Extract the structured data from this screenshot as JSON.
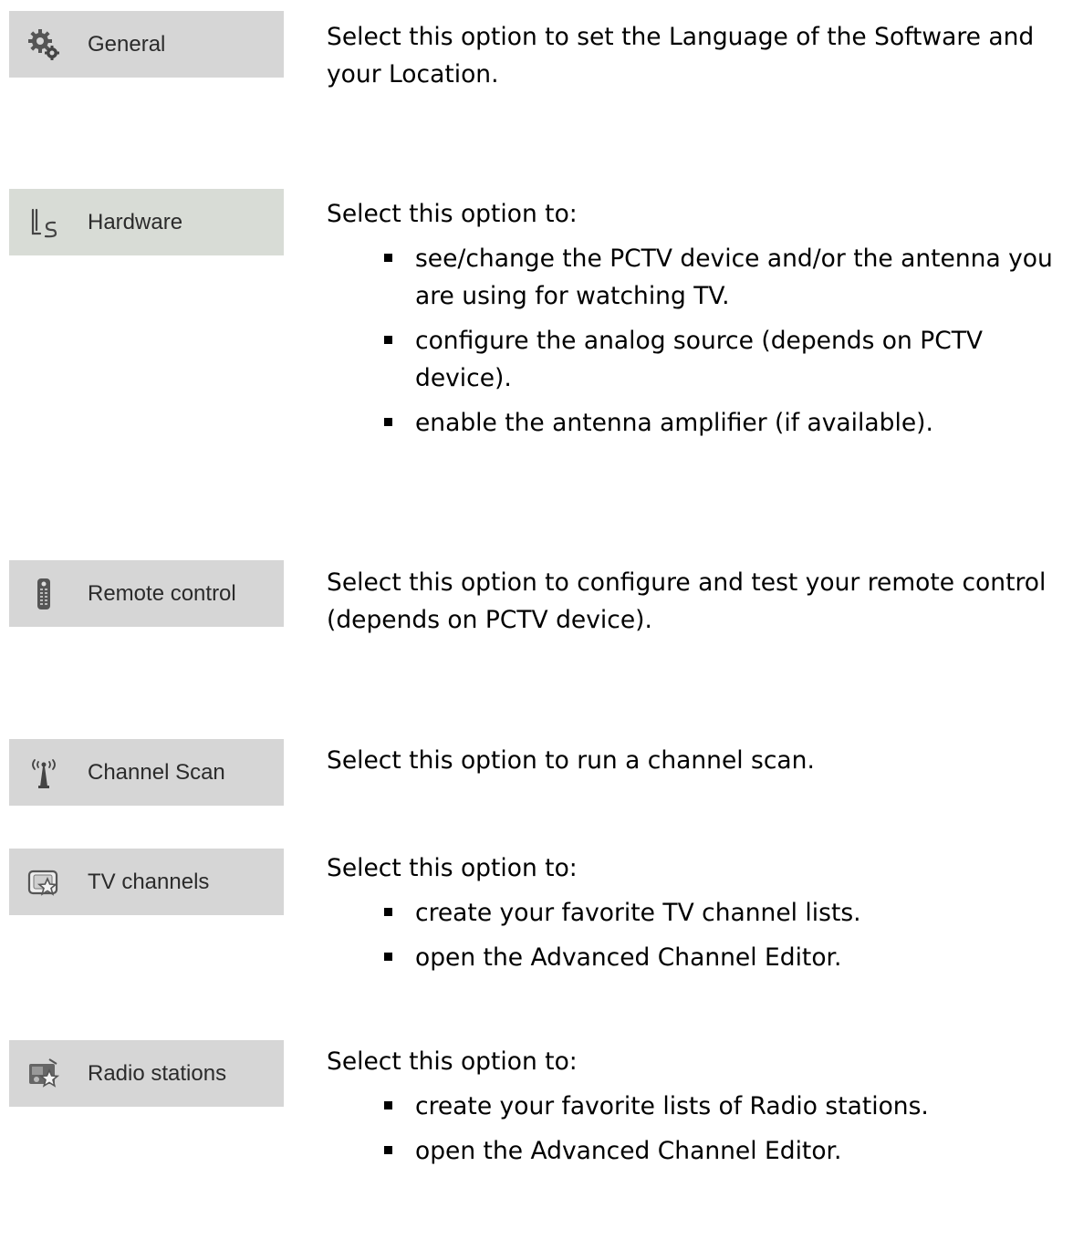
{
  "options": [
    {
      "label": "General",
      "icon": "gears-icon",
      "intro": "Select this option to set the Language of the Software and your Location.",
      "items": []
    },
    {
      "label": "Hardware",
      "icon": "antenna-device-icon",
      "intro": "Select this option to:",
      "items": [
        "see/change the PCTV device and/or the antenna you are using for watching TV.",
        "configure the analog source (depends on PCTV device).",
        "enable the antenna amplifier (if available)."
      ]
    },
    {
      "label": "Remote control",
      "icon": "remote-control-icon",
      "intro": "Select this option to configure and test your remote control (depends on PCTV device).",
      "items": []
    },
    {
      "label": "Channel Scan",
      "icon": "broadcast-tower-icon",
      "intro": "Select this option to run a channel scan.",
      "items": []
    },
    {
      "label": "TV channels",
      "icon": "tv-star-icon",
      "intro": "Select this option to:",
      "items": [
        "create your favorite TV channel lists.",
        "open the Advanced Channel Editor."
      ]
    },
    {
      "label": "Radio stations",
      "icon": "radio-star-icon",
      "intro": "Select this option to:",
      "items": [
        "create your favorite lists of Radio stations.",
        "open the Advanced Channel Editor."
      ]
    }
  ]
}
